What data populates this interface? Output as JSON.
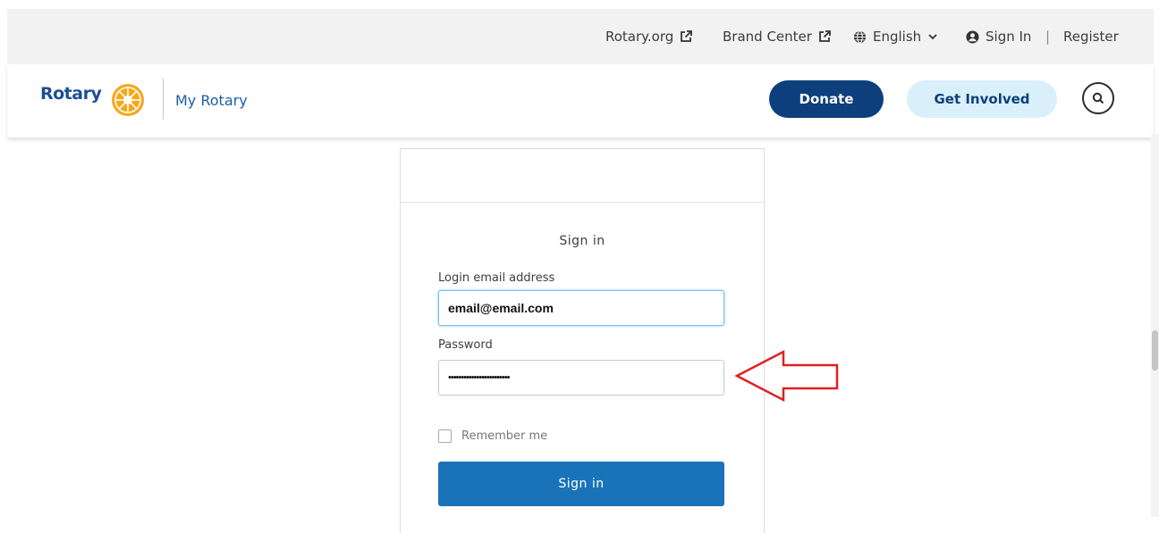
{
  "utility_bar": {
    "rotary_org": "Rotary.org",
    "brand_center": "Brand Center",
    "language": "English",
    "sign_in": "Sign In",
    "separator": "|",
    "register": "Register"
  },
  "header": {
    "logo": "Rotary",
    "my_rotary": "My Rotary",
    "donate": "Donate",
    "get_involved": "Get Involved"
  },
  "signin_form": {
    "title": "Sign in",
    "email_label": "Login email address",
    "email_value": "email@email.com",
    "password_label": "Password",
    "password_value": "••••••••••••••••••••••••",
    "remember_label": "Remember me",
    "submit_label": "Sign in"
  },
  "colors": {
    "brand_navy": "#0d3f7c",
    "brand_gold": "#f7a81b",
    "button_blue": "#1a73b8",
    "annotation_red": "#e0201e"
  }
}
